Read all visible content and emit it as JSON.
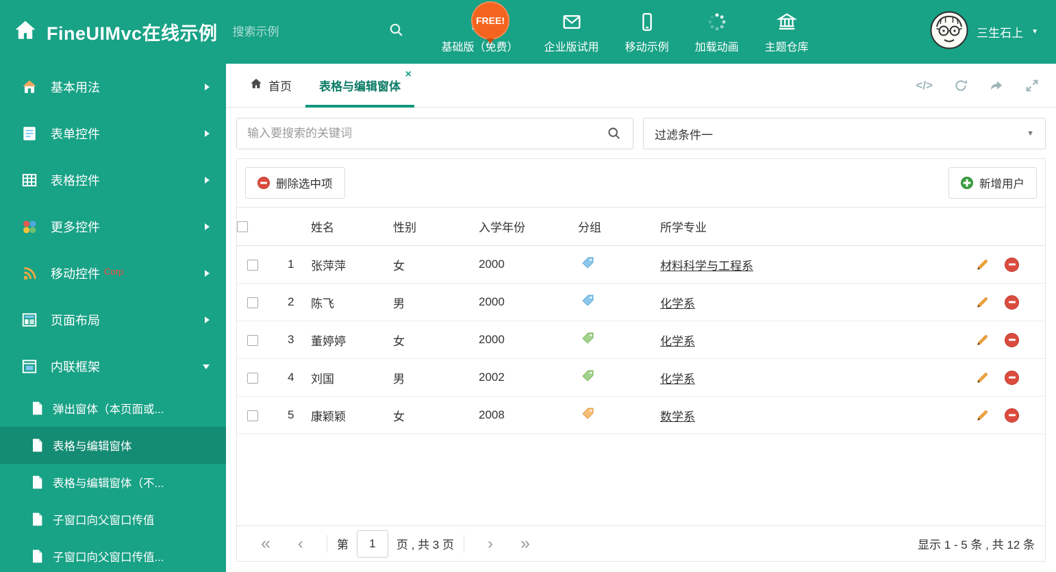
{
  "colors": {
    "theme_green": "#18A286",
    "sidebar_active": "#15806B",
    "tab_active_green": "#0B7B66",
    "free_badge_orange": "#F4641E",
    "delete_red": "#DB4C3F",
    "add_green": "#3F9F42",
    "pencil_orange": "#F2A33C",
    "tag_blue": "#8CC8EC",
    "tag_green": "#A3D48E",
    "tag_orange": "#F7BC77"
  },
  "header": {
    "title": "FineUIMvc在线示例",
    "search_placeholder": "搜索示例",
    "free_badge": "FREE!",
    "nav_items": [
      {
        "label": "基础版（免费）",
        "icon": "download-icon"
      },
      {
        "label": "企业版试用",
        "icon": "envelope-icon"
      },
      {
        "label": "移动示例",
        "icon": "mobile-icon"
      },
      {
        "label": "加载动画",
        "icon": "spinner-icon"
      },
      {
        "label": "主题仓库",
        "icon": "bank-icon"
      }
    ],
    "user_name": "三生石上"
  },
  "sidebar": {
    "items": [
      {
        "label": "基本用法",
        "icon": "home-icon"
      },
      {
        "label": "表单控件",
        "icon": "form-icon"
      },
      {
        "label": "表格控件",
        "icon": "table-icon"
      },
      {
        "label": "更多控件",
        "icon": "more-controls-icon"
      },
      {
        "label": "移动控件",
        "badge": "Corp",
        "icon": "mobile-controls-icon"
      },
      {
        "label": "页面布局",
        "icon": "layout-icon"
      },
      {
        "label": "内联框架",
        "icon": "iframe-icon",
        "expanded": true
      }
    ],
    "subitems": [
      "弹出窗体（本页面或...",
      "表格与编辑窗体",
      "表格与编辑窗体（不...",
      "子窗口向父窗口传值",
      "子窗口向父窗口传值..."
    ],
    "active_subitem": "表格与编辑窗体"
  },
  "tabs": [
    {
      "label": "首页"
    },
    {
      "label": "表格与编辑窗体",
      "active": true
    }
  ],
  "filter": {
    "search_placeholder": "输入要搜索的关键词",
    "dropdown_value": "过滤条件一"
  },
  "toolbar": {
    "delete_label": "删除选中项",
    "add_label": "新增用户"
  },
  "table": {
    "headers": [
      "姓名",
      "性别",
      "入学年份",
      "分组",
      "所学专业"
    ],
    "rows": [
      {
        "num": "1",
        "name": "张萍萍",
        "gender": "女",
        "year": "2000",
        "tag": "tag-blue",
        "major": "材料科学与工程系"
      },
      {
        "num": "2",
        "name": "陈飞",
        "gender": "男",
        "year": "2000",
        "tag": "tag-blue",
        "major": "化学系"
      },
      {
        "num": "3",
        "name": "董婷婷",
        "gender": "女",
        "year": "2000",
        "tag": "tag-green",
        "major": "化学系"
      },
      {
        "num": "4",
        "name": "刘国",
        "gender": "男",
        "year": "2002",
        "tag": "tag-green",
        "major": "化学系"
      },
      {
        "num": "5",
        "name": "康颖颖",
        "gender": "女",
        "year": "2008",
        "tag": "tag-orange",
        "major": "数学系"
      }
    ]
  },
  "pagination": {
    "page_word": "第",
    "current_page": "1",
    "pages_text": "页 , 共 3 页",
    "summary": "显示 1 - 5 条 , 共 12 条"
  },
  "icons": {
    "first_page": "«",
    "prev_page": "‹",
    "next_page": "›",
    "last_page": "»",
    "close": "×",
    "code": "</>",
    "caret_down": "▼"
  }
}
